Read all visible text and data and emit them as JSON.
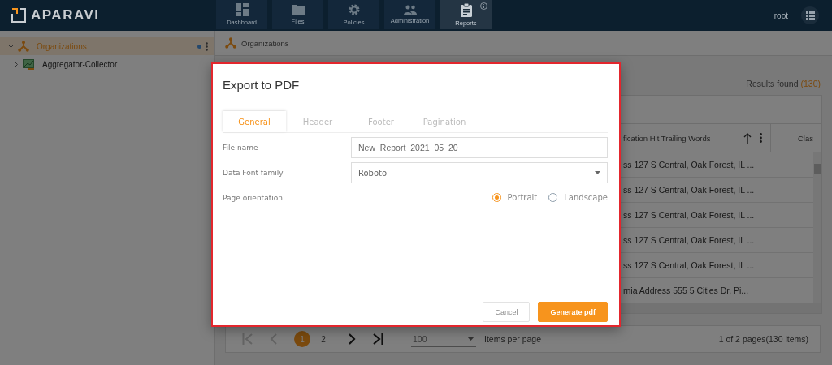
{
  "topbar": {
    "brand": "APARAVI",
    "nav": [
      {
        "label": "Dashboard",
        "kind": "dashboard",
        "selected": false
      },
      {
        "label": "Files",
        "kind": "files",
        "selected": false
      },
      {
        "label": "Policies",
        "kind": "policies",
        "selected": false
      },
      {
        "label": "Administration",
        "kind": "administration",
        "selected": false
      },
      {
        "label": "Reports",
        "kind": "reports",
        "selected": true
      }
    ],
    "user": "root"
  },
  "sidebar": {
    "tree": [
      {
        "label": "Organizations",
        "kind": "organization",
        "expanded": true,
        "selected": true,
        "children": [
          {
            "label": "Aggregator-Collector",
            "kind": "collector",
            "expanded": false,
            "selected": false
          }
        ]
      }
    ]
  },
  "breadcrumb": "Organizations",
  "results": {
    "label": "Results found",
    "count": "(130)"
  },
  "table": {
    "columns": [
      "fication Hit Trailing Words",
      "Clas"
    ],
    "rows": [
      {
        "cell": "ss 127 S Central, Oak Forest, IL ..."
      },
      {
        "cell": "ss 127 S Central, Oak Forest, IL ..."
      },
      {
        "cell": "ss 127 S Central, Oak Forest, IL ..."
      },
      {
        "cell": "ss 127 S Central, Oak Forest, IL ..."
      },
      {
        "cell": "ss 127 S Central, Oak Forest, IL ..."
      },
      {
        "cell": "rnia Address 555 5 Cities Dr, Pi..."
      }
    ]
  },
  "pagination": {
    "controls": [
      {
        "kind": "first",
        "disabled": true
      },
      {
        "kind": "prev",
        "disabled": true
      },
      {
        "kind": "pages"
      },
      {
        "kind": "next",
        "disabled": false
      },
      {
        "kind": "last",
        "disabled": false
      }
    ],
    "pages": [
      {
        "label": "1",
        "selected": true
      },
      {
        "label": "2",
        "selected": false
      }
    ],
    "per_page": "100",
    "per_page_label": "Items per page",
    "summary": "1 of 2 pages(130 items)"
  },
  "dialog": {
    "title": "Export to PDF",
    "tabs": [
      {
        "label": "General",
        "selected": true
      },
      {
        "label": "Header",
        "selected": false
      },
      {
        "label": "Footer",
        "selected": false
      },
      {
        "label": "Pagination",
        "selected": false
      }
    ],
    "fields": [
      {
        "label": "File name",
        "kind": "text",
        "value": "New_Report_2021_05_20"
      },
      {
        "label": "Data Font family",
        "kind": "select",
        "value": "Roboto"
      }
    ],
    "orientation": {
      "label": "Page orientation",
      "options": [
        {
          "label": "Portrait",
          "selected": true
        },
        {
          "label": "Landscape",
          "selected": false
        }
      ]
    },
    "buttons": [
      {
        "label": "Cancel",
        "kind": "secondary"
      },
      {
        "label": "Generate pdf",
        "kind": "primary"
      }
    ]
  }
}
